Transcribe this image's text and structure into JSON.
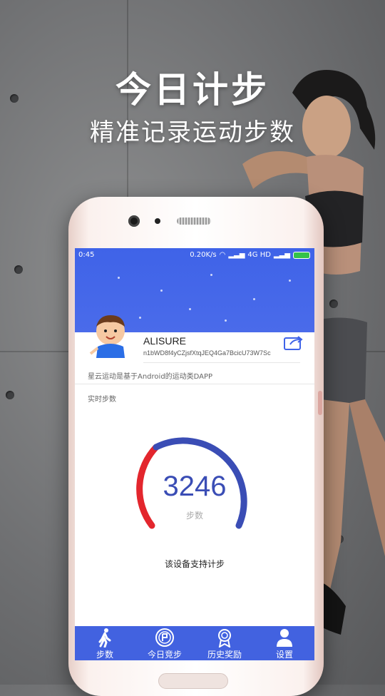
{
  "hero": {
    "title": "今日计步",
    "subtitle": "精准记录运动步数"
  },
  "status_bar": {
    "time": "0:45",
    "speed": "0.20K/s",
    "network": "4G HD"
  },
  "profile": {
    "username": "ALISURE",
    "address": "n1bWD8f4yCZjsfXtqJEQ4Ga7BcicU73W7Sc",
    "description": "星云运动是基于Android的运动类DAPP"
  },
  "steps": {
    "section_label": "实时步数",
    "value": "3246",
    "unit": "步数",
    "support_text": "该设备支持计步"
  },
  "tabs": [
    {
      "label": "步数",
      "icon": "walking-icon"
    },
    {
      "label": "今日竞步",
      "icon": "compete-badge-icon"
    },
    {
      "label": "历史奖励",
      "icon": "medal-icon"
    },
    {
      "label": "设置",
      "icon": "user-icon"
    }
  ],
  "colors": {
    "primary": "#4262e0",
    "gauge_blue": "#3a4db5",
    "gauge_red": "#e3262d"
  }
}
